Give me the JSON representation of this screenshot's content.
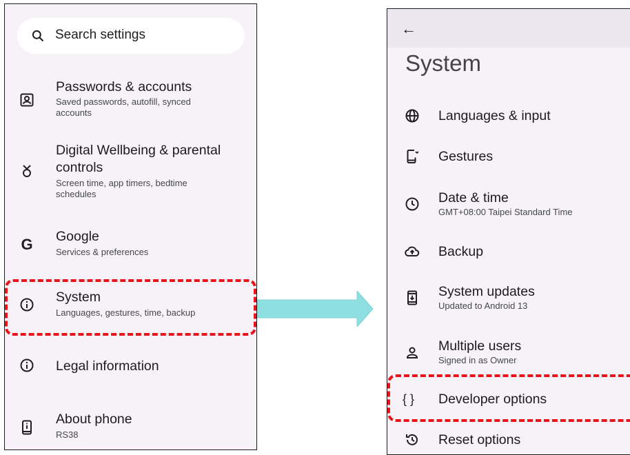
{
  "left_screen": {
    "search": {
      "placeholder": "Search settings"
    },
    "items": [
      {
        "icon": "account-box-icon",
        "title": "Passwords & accounts",
        "subtitle_lines": [
          "Saved passwords, autofill, synced",
          "accounts"
        ]
      },
      {
        "icon": "wellbeing-icon",
        "title_lines": [
          "Digital Wellbeing & parental",
          "controls"
        ],
        "subtitle_lines": [
          "Screen time, app timers, bedtime",
          "schedules"
        ]
      },
      {
        "icon": "google-icon",
        "title": "Google",
        "subtitle": "Services & preferences"
      },
      {
        "icon": "info-icon",
        "title": "System",
        "subtitle": "Languages, gestures, time, backup"
      },
      {
        "icon": "info-icon",
        "title": "Legal information"
      },
      {
        "icon": "phone-icon",
        "title": "About phone",
        "subtitle": "RS38"
      }
    ]
  },
  "right_screen": {
    "back_icon": "arrow-back-icon",
    "title": "System",
    "items": [
      {
        "icon": "globe-icon",
        "title": "Languages & input"
      },
      {
        "icon": "gestures-icon",
        "title": "Gestures"
      },
      {
        "icon": "clock-icon",
        "title": "Date & time",
        "subtitle": "GMT+08:00 Taipei Standard Time"
      },
      {
        "icon": "cloud-upload-icon",
        "title": "Backup"
      },
      {
        "icon": "system-update-icon",
        "title": "System updates",
        "subtitle": "Updated to Android 13"
      },
      {
        "icon": "person-icon",
        "title": "Multiple users",
        "subtitle": "Signed in as Owner"
      },
      {
        "icon": "braces-icon",
        "glyph": "{ }",
        "title": "Developer options"
      },
      {
        "icon": "restore-icon",
        "title": "Reset options"
      }
    ]
  },
  "annotations": {
    "highlight_color": "#e8141a",
    "arrow_color": "#8edfe0"
  }
}
